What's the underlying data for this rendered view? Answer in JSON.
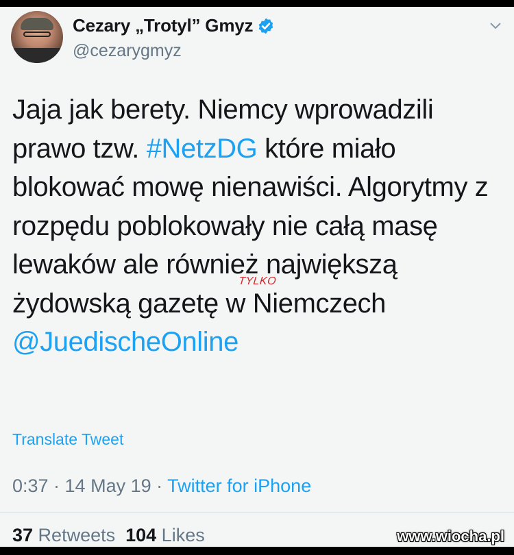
{
  "user": {
    "display_name": "Cezary „Trotyl” Gmyz",
    "handle": "@cezarygmyz",
    "verified_icon": "verified-badge-icon",
    "avatar_icon": "avatar-photo"
  },
  "menu": {
    "icon": "chevron-down-icon"
  },
  "tweet": {
    "t1": "Jaja jak berety. Niemcy wprowadzili prawo tzw. ",
    "hashtag": "#NetzDG",
    "t2": " które miało blokować mowę nienawiści. Algorytmy z rozpędu poblokowały nie całą masę lewaków ale również największą żydowską gazetę w Niemczech ",
    "mention": "@JuedischeOnline",
    "annotation": "TYLKO"
  },
  "translate_label": "Translate Tweet",
  "meta": {
    "time_date": "0:37 · 14 May 19 · ",
    "source": "Twitter for iPhone"
  },
  "stats": {
    "retweets_count": "37",
    "retweets_label": " Retweets  ",
    "likes_count": "104",
    "likes_label": " Likes"
  },
  "watermark": "www.wiocha.pl",
  "colors": {
    "link": "#1da1f2",
    "text": "#14171a",
    "muted": "#657786",
    "annotation": "#d8252b"
  }
}
